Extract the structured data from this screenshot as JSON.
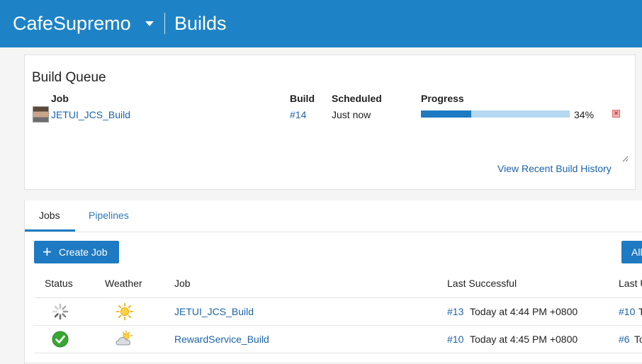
{
  "header": {
    "brand": "CafeSupremo",
    "section": "Builds"
  },
  "build_queue": {
    "title": "Build Queue",
    "columns": {
      "job": "Job",
      "build": "Build",
      "scheduled": "Scheduled",
      "progress": "Progress"
    },
    "item": {
      "job": "JETUI_JCS_Build",
      "build": "#14",
      "scheduled": "Just now",
      "progress_percent": 34,
      "progress_label": "34%"
    },
    "history_link": "View Recent Build History"
  },
  "tabs": {
    "jobs": "Jobs",
    "pipelines": "Pipelines",
    "active": "jobs"
  },
  "toolbar": {
    "create_job": "Create Job",
    "all_button": "All"
  },
  "jobs_table": {
    "headers": {
      "status": "Status",
      "weather": "Weather",
      "job": "Job",
      "last_successful": "Last Successful",
      "last_unsuccessful": "Last U"
    },
    "rows": [
      {
        "status": "running",
        "weather": "sunny",
        "job": "JETUI_JCS_Build",
        "last_successful_build": "#13",
        "last_successful_time": "Today at 4:44 PM +0800",
        "last_unsuccessful_build": "#10",
        "last_unsuccessful_time": "T"
      },
      {
        "status": "success",
        "weather": "partly-cloudy",
        "job": "RewardService_Build",
        "last_successful_build": "#10",
        "last_successful_time": "Today at 4:45 PM +0800",
        "last_unsuccessful_build": "#6",
        "last_unsuccessful_time": "To"
      }
    ]
  },
  "colors": {
    "header_bg": "#1e83c6",
    "accent": "#1e7ac2",
    "link": "#1c64a8",
    "progress_track": "#b6d8f0",
    "success": "#3aa534"
  },
  "icons": {
    "brand_menu": "chevron-down-icon",
    "queue_avatar": "avatar",
    "cancel": "close-icon",
    "create": "plus-icon",
    "running": "spinner-icon",
    "success": "check-circle-icon",
    "sunny": "sun-icon",
    "partly_cloudy": "cloud-sun-icon"
  }
}
